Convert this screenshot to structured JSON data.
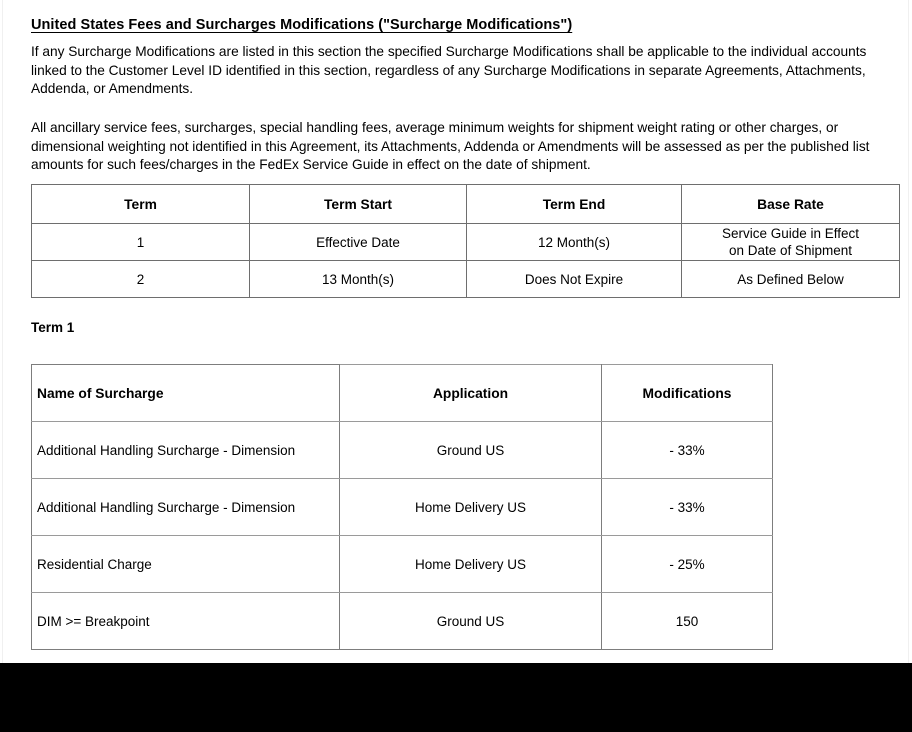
{
  "document": {
    "section_title": "United States Fees and Surcharges Modifications (\"Surcharge Modifications\")",
    "paragraphs": [
      "If any Surcharge Modifications are listed in this section the specified Surcharge Modifications shall be applicable to the individual accounts linked to the Customer Level ID identified in this section, regardless of any Surcharge Modifications in separate Agreements, Attachments, Addenda, or Amendments.",
      "All ancillary service fees, surcharges, special handling fees, average minimum weights for shipment weight rating or other charges, or dimensional weighting not identified in this Agreement, its Attachments, Addenda or Amendments will be assessed as per the published list amounts for such fees/charges in the FedEx Service Guide in effect on the date of shipment."
    ],
    "term_subheading": "Term 1"
  },
  "term_table": {
    "headers": [
      "Term",
      "Term Start",
      "Term End",
      "Base Rate"
    ],
    "rows": [
      {
        "term": "1",
        "term_start": "Effective Date",
        "term_end": "12 Month(s)",
        "base_rate_line1": "Service Guide in Effect",
        "base_rate_line2": "on Date of Shipment"
      },
      {
        "term": "2",
        "term_start": "13 Month(s)",
        "term_end": "Does Not Expire",
        "base_rate_line1": "As Defined Below",
        "base_rate_line2": ""
      }
    ]
  },
  "surcharge_table": {
    "headers": [
      "Name of Surcharge",
      "Application",
      "Modifications"
    ],
    "rows": [
      {
        "name": "Additional Handling Surcharge - Dimension",
        "application": "Ground US",
        "modification": "- 33%"
      },
      {
        "name": "Additional Handling Surcharge - Dimension",
        "application": "Home Delivery US",
        "modification": "- 33%"
      },
      {
        "name": "Residential Charge",
        "application": "Home Delivery US",
        "modification": "- 25%"
      },
      {
        "name": "DIM >= Breakpoint",
        "application": "Ground US",
        "modification": "150"
      }
    ]
  },
  "colors": {
    "text": "#000000",
    "table_border": "#6e6e6e",
    "page_background": "#ffffff",
    "bottom_bar": "#000000"
  }
}
